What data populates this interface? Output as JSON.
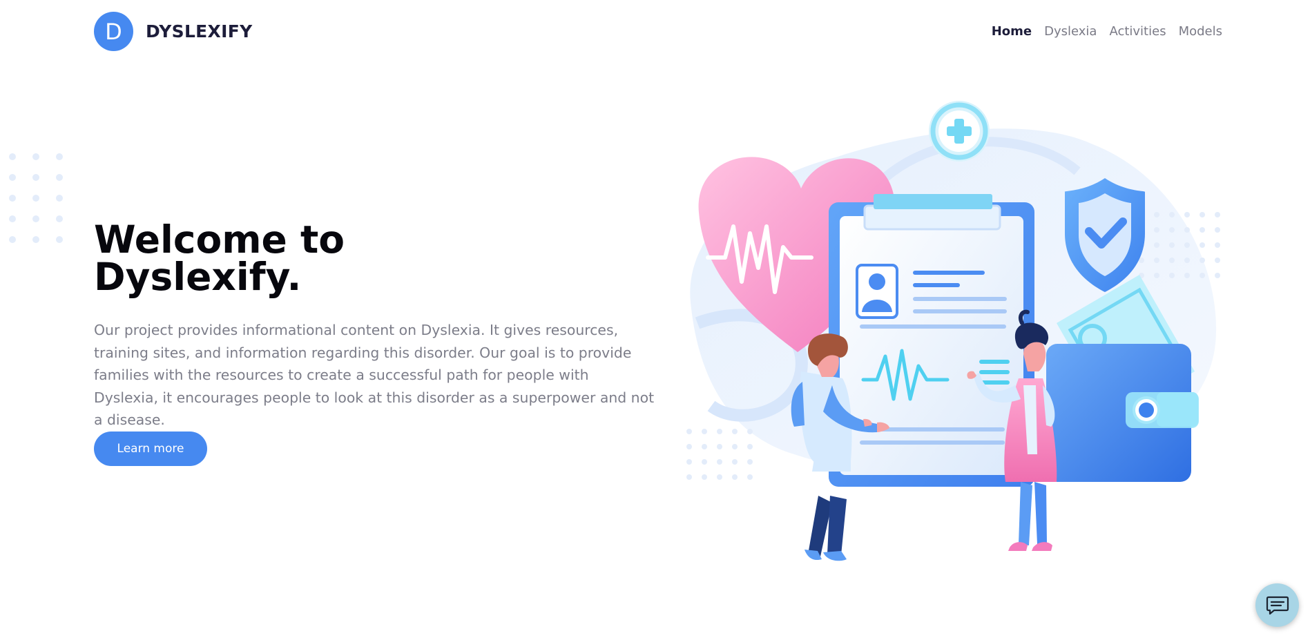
{
  "brand": {
    "logo_letter": "D",
    "name": "DYSLEXIFY"
  },
  "nav": {
    "items": [
      {
        "label": "Home",
        "active": true
      },
      {
        "label": "Dyslexia",
        "active": false
      },
      {
        "label": "Activities",
        "active": false
      },
      {
        "label": "Models",
        "active": false
      }
    ]
  },
  "hero": {
    "title_line1": "Welcome to",
    "title_line2": "Dyslexify.",
    "description": "Our project provides informational content on Dyslexia. It gives resources, training sites, and information regarding this disorder. Our goal is to provide families with the resources to create a successful path for people with Dyslexia, it encourages people to look at this disorder as a superpower and not a disease.",
    "cta_label": "Learn more"
  },
  "illustration": {
    "name": "medical-checkup-illustration"
  },
  "chat": {
    "icon": "chat-icon"
  },
  "colors": {
    "accent": "#4689f0",
    "heading": "#07070d",
    "body_text": "#7c7d89",
    "chat_bg": "#a8d5e6"
  }
}
